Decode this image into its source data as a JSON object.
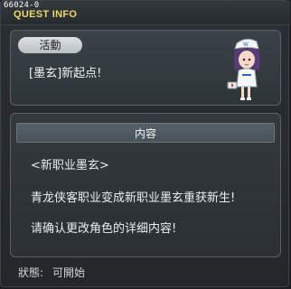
{
  "window": {
    "quest_id": "66024-0",
    "title": "QUEST INFO"
  },
  "summary": {
    "badge": "活動",
    "quest_title": "[墨玄]新起点!"
  },
  "contents": {
    "header": "内容",
    "line1": "<新职业墨玄>",
    "line2": "青龙侠客职业变成新职业墨玄重获新生!",
    "line3": "请确认更改角色的详细内容!"
  },
  "status": {
    "label": "狀態:",
    "value": "可開始"
  },
  "icons": {
    "npc": "nurse-npc-portrait"
  }
}
